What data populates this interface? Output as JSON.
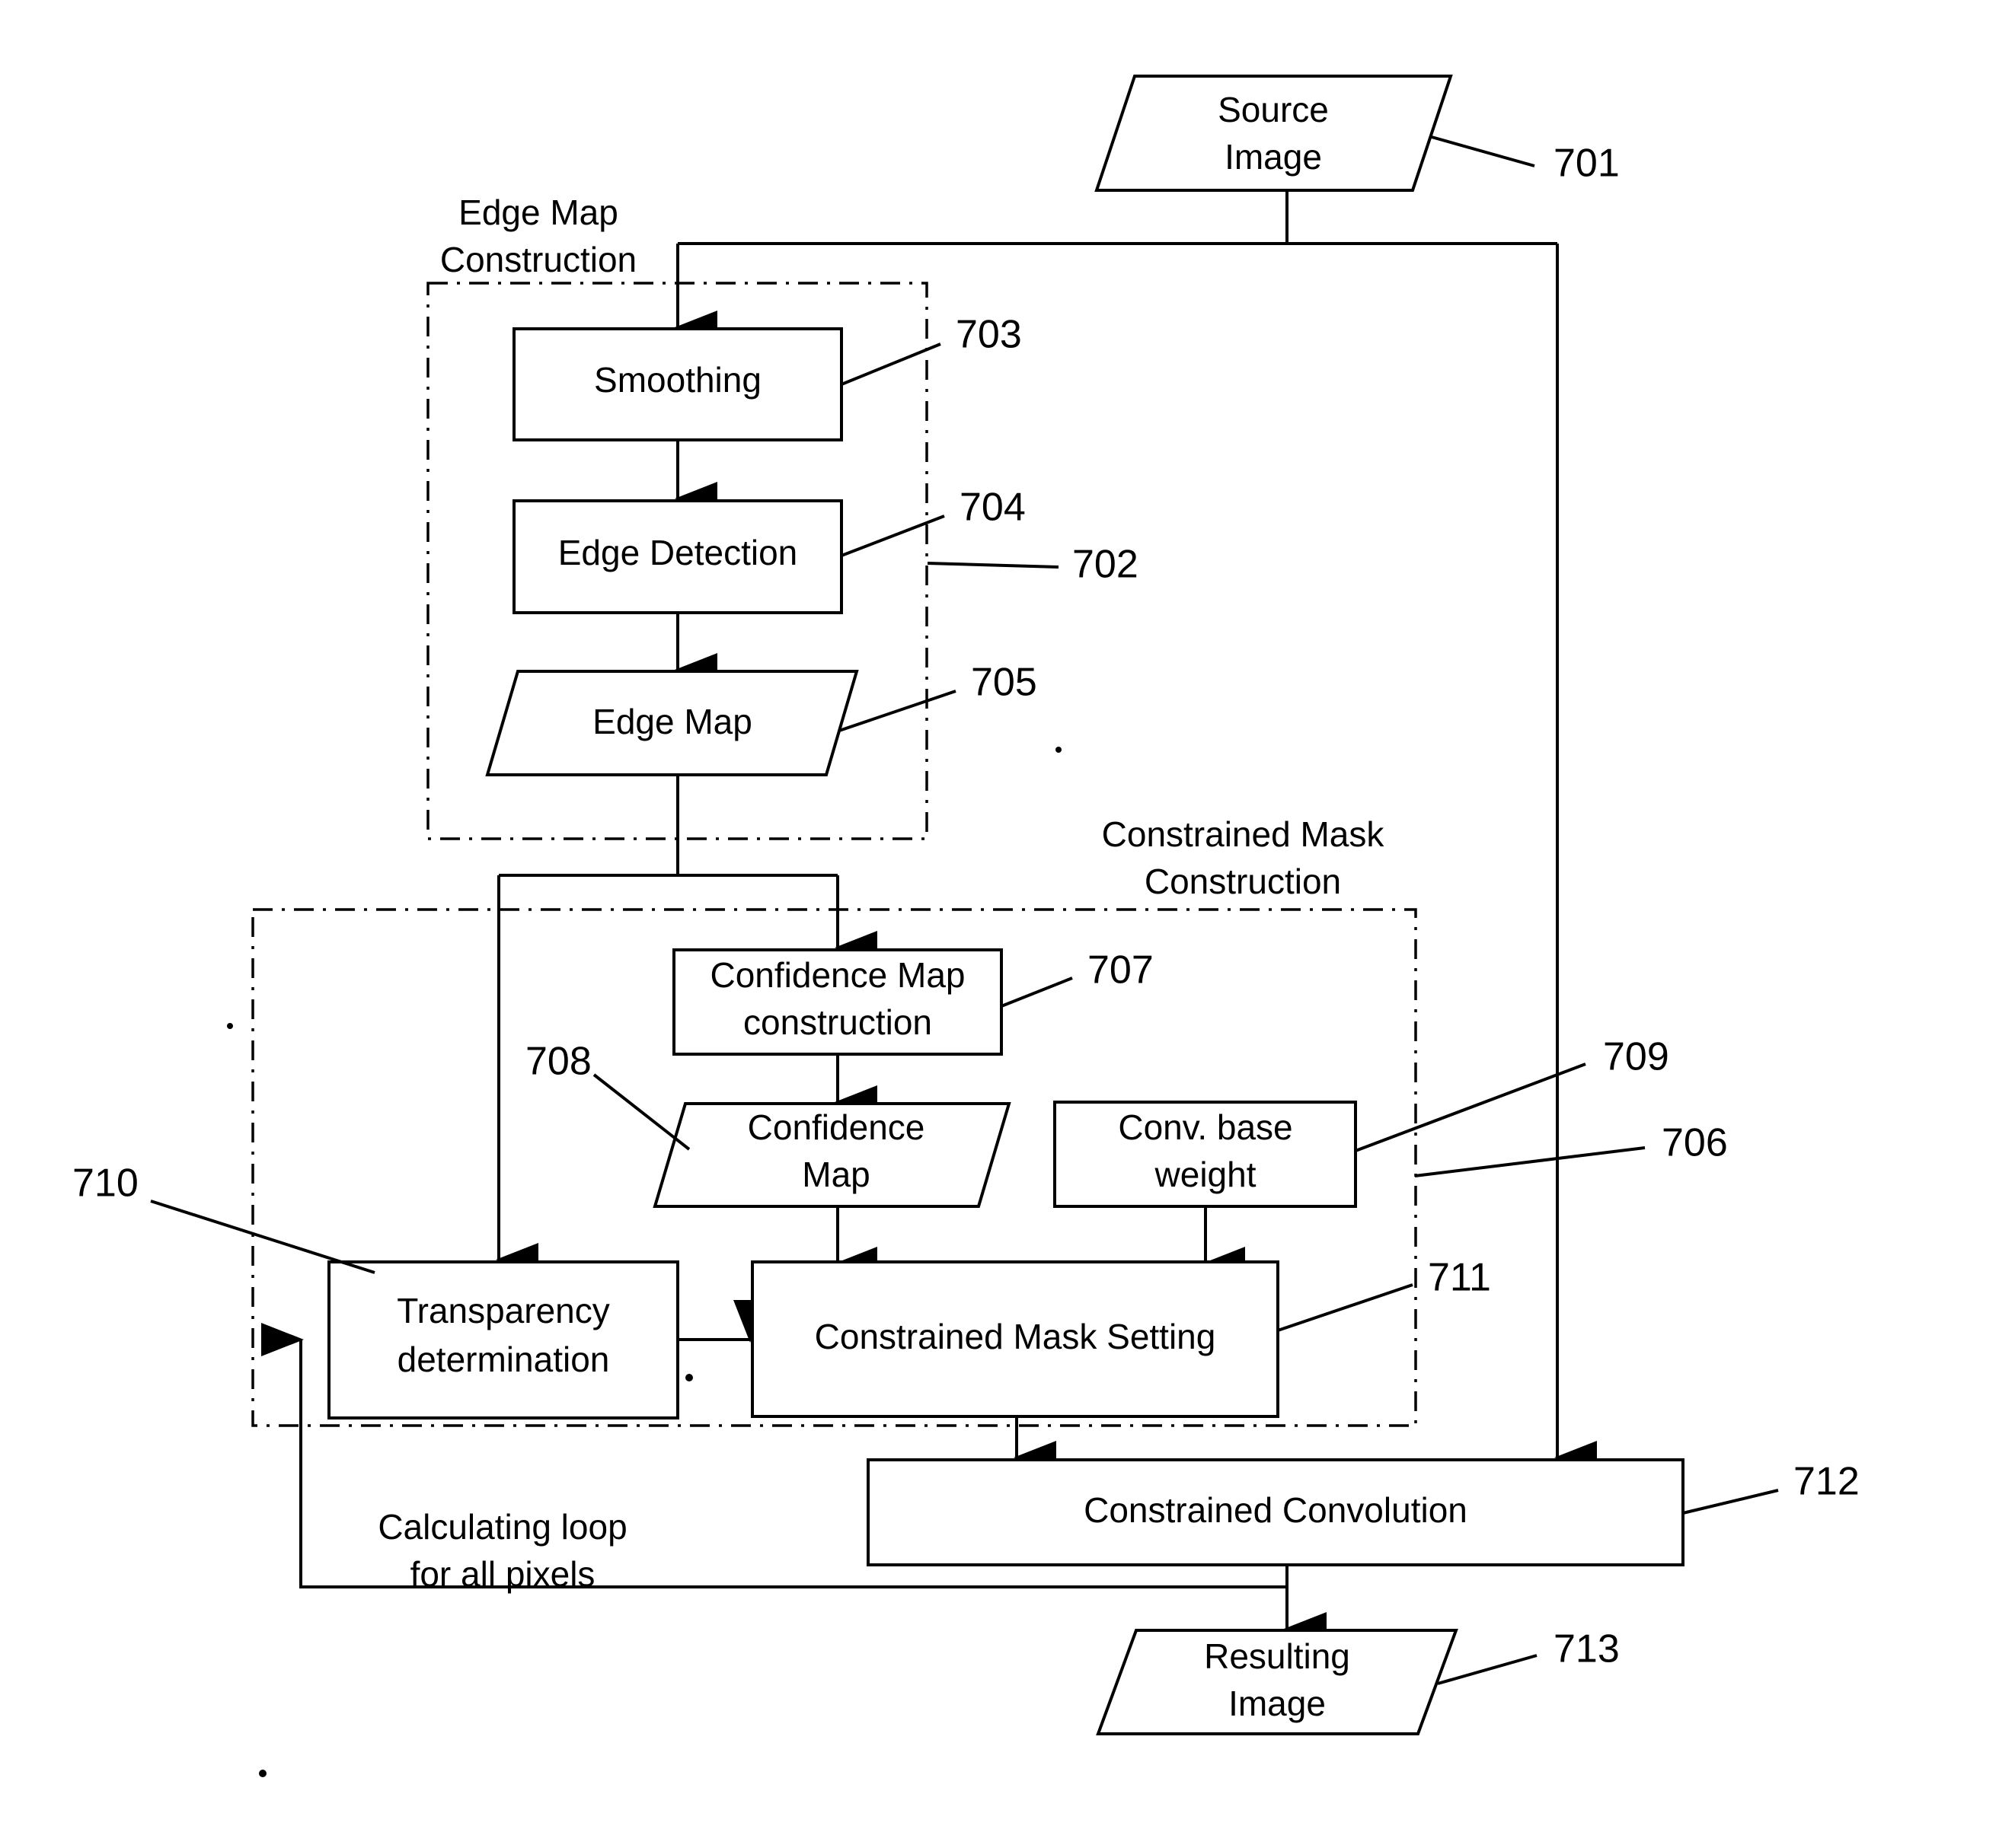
{
  "figure": {
    "type": "patent-flowchart",
    "nodes": [
      {
        "id": "source_image",
        "ref": "701",
        "label_line1": "Source",
        "label_line2": "Image",
        "shape": "parallelogram"
      },
      {
        "id": "smoothing",
        "ref": "703",
        "label_line1": "Smoothing",
        "label_line2": "",
        "shape": "rectangle"
      },
      {
        "id": "edge_detection",
        "ref": "704",
        "label_line1": "Edge Detection",
        "label_line2": "",
        "shape": "rectangle"
      },
      {
        "id": "edge_map",
        "ref": "705",
        "label_line1": "Edge Map",
        "label_line2": "",
        "shape": "parallelogram"
      },
      {
        "id": "conf_map_constr",
        "ref": "707",
        "label_line1": "Confidence Map",
        "label_line2": "construction",
        "shape": "rectangle"
      },
      {
        "id": "confidence_map",
        "ref": "708",
        "label_line1": "Confidence",
        "label_line2": "Map",
        "shape": "parallelogram"
      },
      {
        "id": "conv_base_wt",
        "ref": "709",
        "label_line1": "Conv. base",
        "label_line2": "weight",
        "shape": "rectangle"
      },
      {
        "id": "transparency",
        "ref": "710",
        "label_line1": "Transparency",
        "label_line2": "determination",
        "shape": "rectangle"
      },
      {
        "id": "mask_setting",
        "ref": "711",
        "label_line1": "Constrained Mask Setting",
        "label_line2": "",
        "shape": "rectangle"
      },
      {
        "id": "convolution",
        "ref": "712",
        "label_line1": "Constrained Convolution",
        "label_line2": "",
        "shape": "rectangle"
      },
      {
        "id": "result_image",
        "ref": "713",
        "label_line1": "Resulting",
        "label_line2": "Image",
        "shape": "parallelogram"
      }
    ],
    "groups": [
      {
        "id": "edge_map_construction",
        "ref": "702",
        "title_line1": "Edge Map",
        "title_line2": "Construction"
      },
      {
        "id": "mask_construction",
        "ref": "706",
        "title_line1": "Constrained Mask",
        "title_line2": "Construction"
      }
    ],
    "annotations": [
      {
        "id": "calc_loop",
        "line1": "Calculating loop",
        "line2": "for all pixels"
      }
    ],
    "refs": {
      "r701": "701",
      "r702": "702",
      "r703": "703",
      "r704": "704",
      "r705": "705",
      "r706": "706",
      "r707": "707",
      "r708": "708",
      "r709": "709",
      "r710": "710",
      "r711": "711",
      "r712": "712",
      "r713": "713"
    },
    "colors": {
      "ink": "#000000",
      "paper": "#ffffff"
    }
  }
}
